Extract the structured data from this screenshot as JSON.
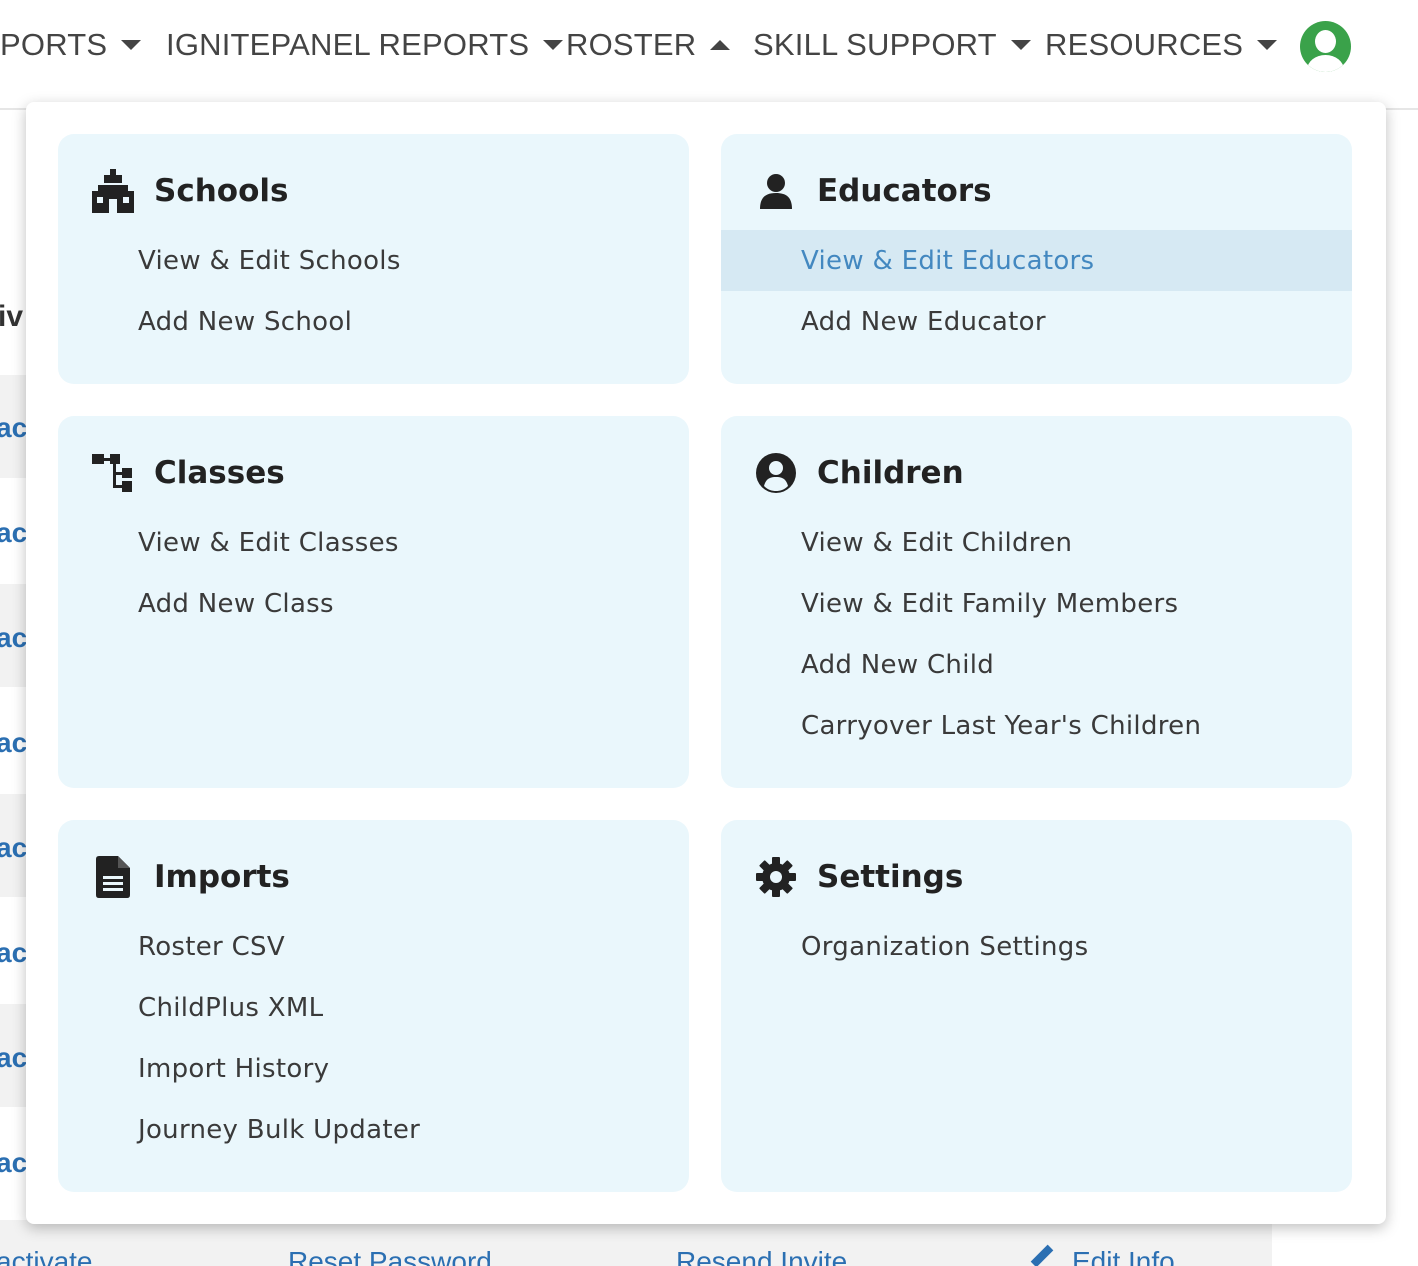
{
  "nav": {
    "items": [
      {
        "label": "PORTS",
        "caret": "down"
      },
      {
        "label": "IGNITEPANEL REPORTS",
        "caret": "down"
      },
      {
        "label": "ROSTER",
        "caret": "up"
      },
      {
        "label": "SKILL SUPPORT",
        "caret": "down"
      },
      {
        "label": "RESOURCES",
        "caret": "down"
      }
    ],
    "avatar_icon": "user-avatar-icon",
    "avatar_color": "#3aa24a"
  },
  "background": {
    "row_fragment": "act",
    "heading_fragment": "iv",
    "bottom_links": [
      "activate",
      "Reset Password",
      "Resend Invite",
      "Edit Info"
    ]
  },
  "menu": {
    "sections": [
      {
        "title": "Schools",
        "icon": "school-icon",
        "links": [
          "View & Edit Schools",
          "Add New School"
        ]
      },
      {
        "title": "Educators",
        "icon": "person-icon",
        "links": [
          "View & Edit Educators",
          "Add New Educator"
        ],
        "active_link": 0
      },
      {
        "title": "Classes",
        "icon": "sitemap-icon",
        "links": [
          "View & Edit Classes",
          "Add New Class"
        ]
      },
      {
        "title": "Children",
        "icon": "user-circle-icon",
        "links": [
          "View & Edit Children",
          "View & Edit Family Members",
          "Add New Child",
          "Carryover Last Year's Children"
        ]
      },
      {
        "title": "Imports",
        "icon": "file-icon",
        "links": [
          "Roster CSV",
          "ChildPlus XML",
          "Import History",
          "Journey Bulk Updater"
        ]
      },
      {
        "title": "Settings",
        "icon": "gear-icon",
        "links": [
          "Organization Settings"
        ]
      }
    ]
  },
  "colors": {
    "card_background": "#eaf7fc",
    "active_link_background": "#d6e9f3",
    "active_link_text": "#4388c0",
    "link_blue": "#2b6fb2"
  }
}
